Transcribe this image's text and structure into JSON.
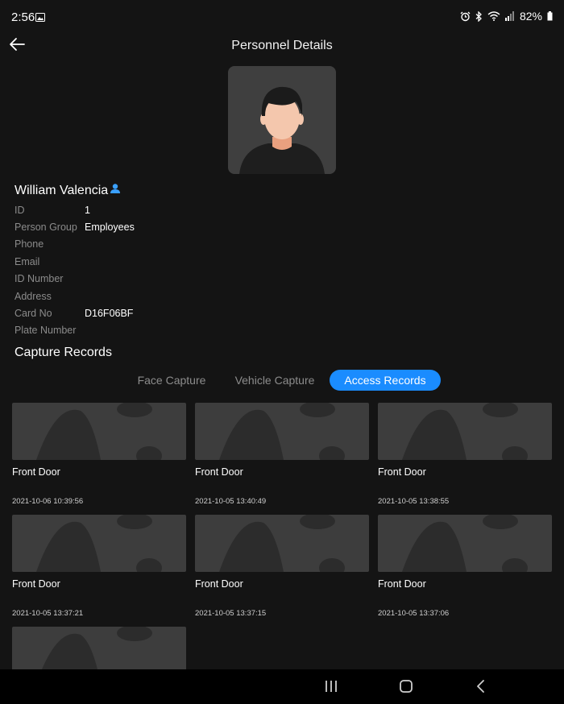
{
  "status_bar": {
    "time": "2:56",
    "battery": "82%",
    "icons": [
      "gallery-icon",
      "alarm-icon",
      "bluetooth-icon",
      "wifi-icon",
      "signal-icon",
      "battery-icon"
    ]
  },
  "header": {
    "title": "Personnel Details",
    "back_icon": "arrow-left-icon"
  },
  "person": {
    "name": "William Valencia",
    "name_icon": "person-icon",
    "fields": [
      {
        "label": "ID",
        "value": "1"
      },
      {
        "label": "Person Group",
        "value": "Employees"
      },
      {
        "label": "Phone",
        "value": ""
      },
      {
        "label": "Email",
        "value": ""
      },
      {
        "label": "ID Number",
        "value": ""
      },
      {
        "label": "Address",
        "value": ""
      },
      {
        "label": "Card No",
        "value": "D16F06BF"
      },
      {
        "label": "Plate Number",
        "value": ""
      }
    ]
  },
  "capture": {
    "title": "Capture Records",
    "tabs": [
      {
        "label": "Face Capture",
        "active": false
      },
      {
        "label": "Vehicle Capture",
        "active": false
      },
      {
        "label": "Access Records",
        "active": true
      }
    ],
    "records": [
      {
        "location": "Front Door",
        "time": "2021-10-06 10:39:56"
      },
      {
        "location": "Front Door",
        "time": "2021-10-05 13:40:49"
      },
      {
        "location": "Front Door",
        "time": "2021-10-05 13:38:55"
      },
      {
        "location": "Front Door",
        "time": "2021-10-05 13:37:21"
      },
      {
        "location": "Front Door",
        "time": "2021-10-05 13:37:15"
      },
      {
        "location": "Front Door",
        "time": "2021-10-05 13:37:06"
      },
      {
        "location": "",
        "time": ""
      }
    ]
  },
  "colors": {
    "background": "#141414",
    "accent": "#1a8cff",
    "label": "#8b8b8b"
  },
  "nav_bar": {
    "icons": [
      "recent-apps-icon",
      "home-icon",
      "back-icon"
    ]
  }
}
